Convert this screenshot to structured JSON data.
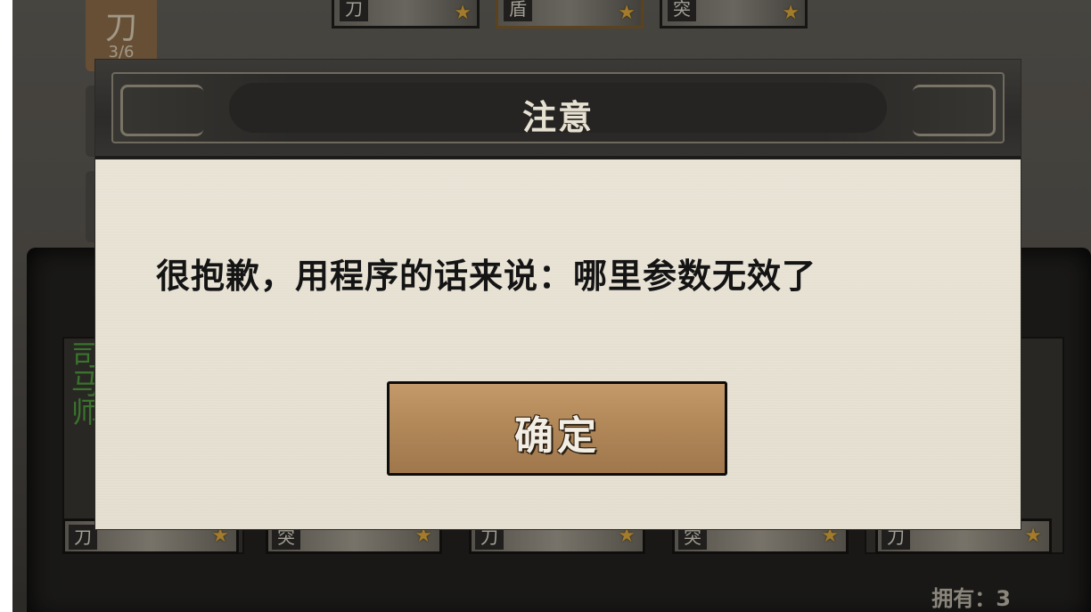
{
  "background": {
    "category_tab": {
      "glyph": "刀",
      "count": "3/6"
    },
    "top_cards": [
      {
        "tag": "刀",
        "star": "★"
      },
      {
        "tag": "盾",
        "star": "★"
      },
      {
        "tag": "突",
        "star": "★"
      }
    ],
    "bottom_cards": [
      {
        "tag": "刀",
        "star": "★"
      },
      {
        "tag": "突",
        "star": "★"
      },
      {
        "tag": "刀",
        "star": "★"
      },
      {
        "tag": "突",
        "star": "★"
      },
      {
        "tag": "刀",
        "star": "★"
      }
    ],
    "green_name": "司马师",
    "owned_label": "拥有：3"
  },
  "dialog": {
    "title": "注意",
    "message": "很抱歉，用程序的话来说：哪里参数无效了",
    "confirm_label": "确定"
  },
  "colors": {
    "dialog_paper": "#e9e3d6",
    "header_dark": "#2c2b29",
    "button_brown": "#b48a5a",
    "star_gold": "#d8a43b",
    "green_text": "#4d9a3c"
  }
}
